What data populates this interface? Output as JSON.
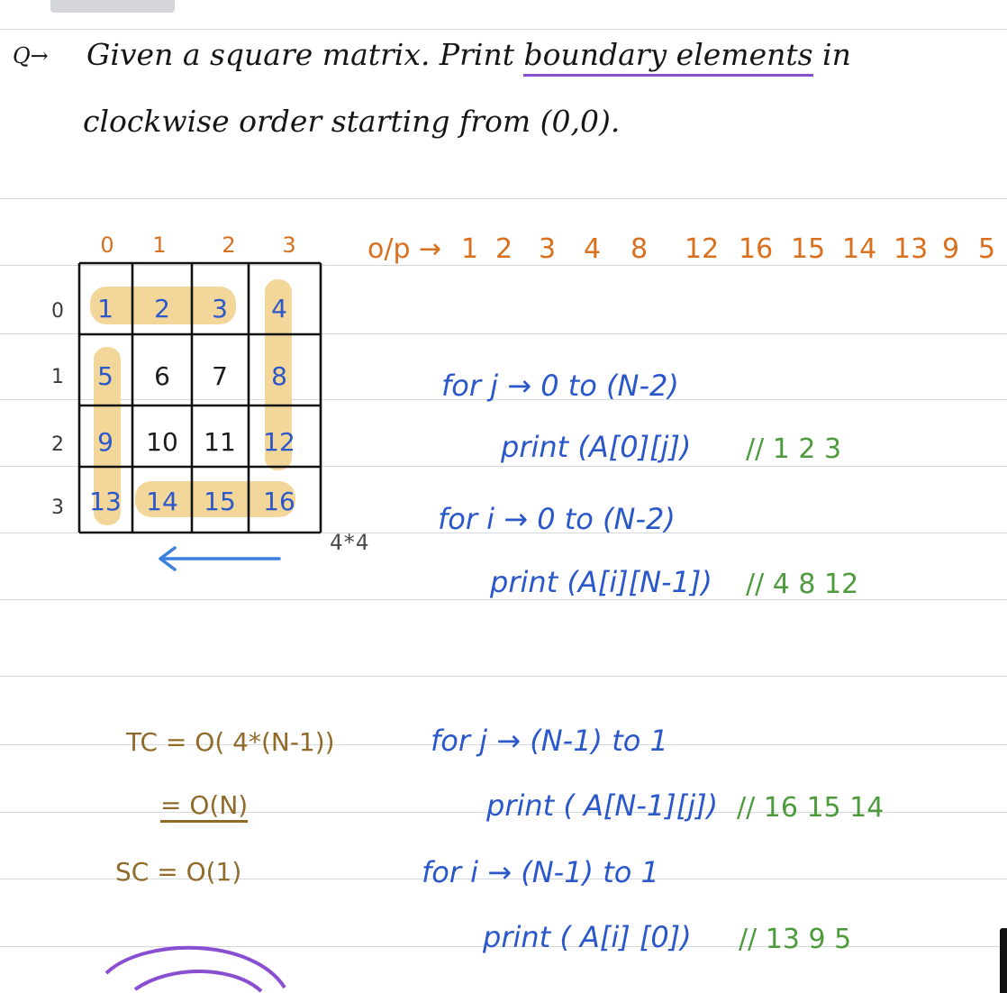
{
  "question": {
    "marker": "Q→",
    "line1_plain": "Given a square matrix. Print ",
    "line1_underlined": "boundary elements",
    "line1_tail": " in",
    "line2": "clockwise order starting from (0,0)."
  },
  "matrix": {
    "col_indices": [
      "0",
      "1",
      "2",
      "3"
    ],
    "row_indices": [
      "0",
      "1",
      "2",
      "3"
    ],
    "cells": [
      [
        "1",
        "2",
        "3",
        "4"
      ],
      [
        "5",
        "6",
        "7",
        "8"
      ],
      [
        "9",
        "10",
        "11",
        "12"
      ],
      [
        "13",
        "14",
        "15",
        "16"
      ]
    ],
    "size_label": "4*4",
    "highlight_color": "#f3d79a",
    "arrow_color": "#3b7fe0"
  },
  "output": {
    "label": "o/p →",
    "values": [
      "1",
      "2",
      "3",
      "4",
      "8",
      "12",
      "16",
      "15",
      "14",
      "13",
      "9",
      "5"
    ]
  },
  "loops": [
    {
      "header": "for j → 0 to (N-2)",
      "body": "print (A[0][j])",
      "comment": "// 1 2 3"
    },
    {
      "header": "for i → 0 to (N-2)",
      "body": "print (A[i][N-1])",
      "comment": "// 4 8 12"
    },
    {
      "header": "for j → (N-1) to 1",
      "body": "print ( A[N-1][j])",
      "comment": "// 16 15 14"
    },
    {
      "header": "for i → (N-1) to 1",
      "body": "print ( A[i] [0])",
      "comment": "// 13 9 5"
    }
  ],
  "complexity": {
    "tc_line1": "TC = O( 4*(N-1))",
    "tc_line2": "= O(N)",
    "sc": "SC = O(1)"
  },
  "colors": {
    "black_ink": "#161616",
    "blue_ink": "#2a57c9",
    "green_ink": "#4d9b3c",
    "orange_ink": "#d8701f",
    "brown_ink": "#8f6a28",
    "purple_ink": "#8a4fd1"
  }
}
